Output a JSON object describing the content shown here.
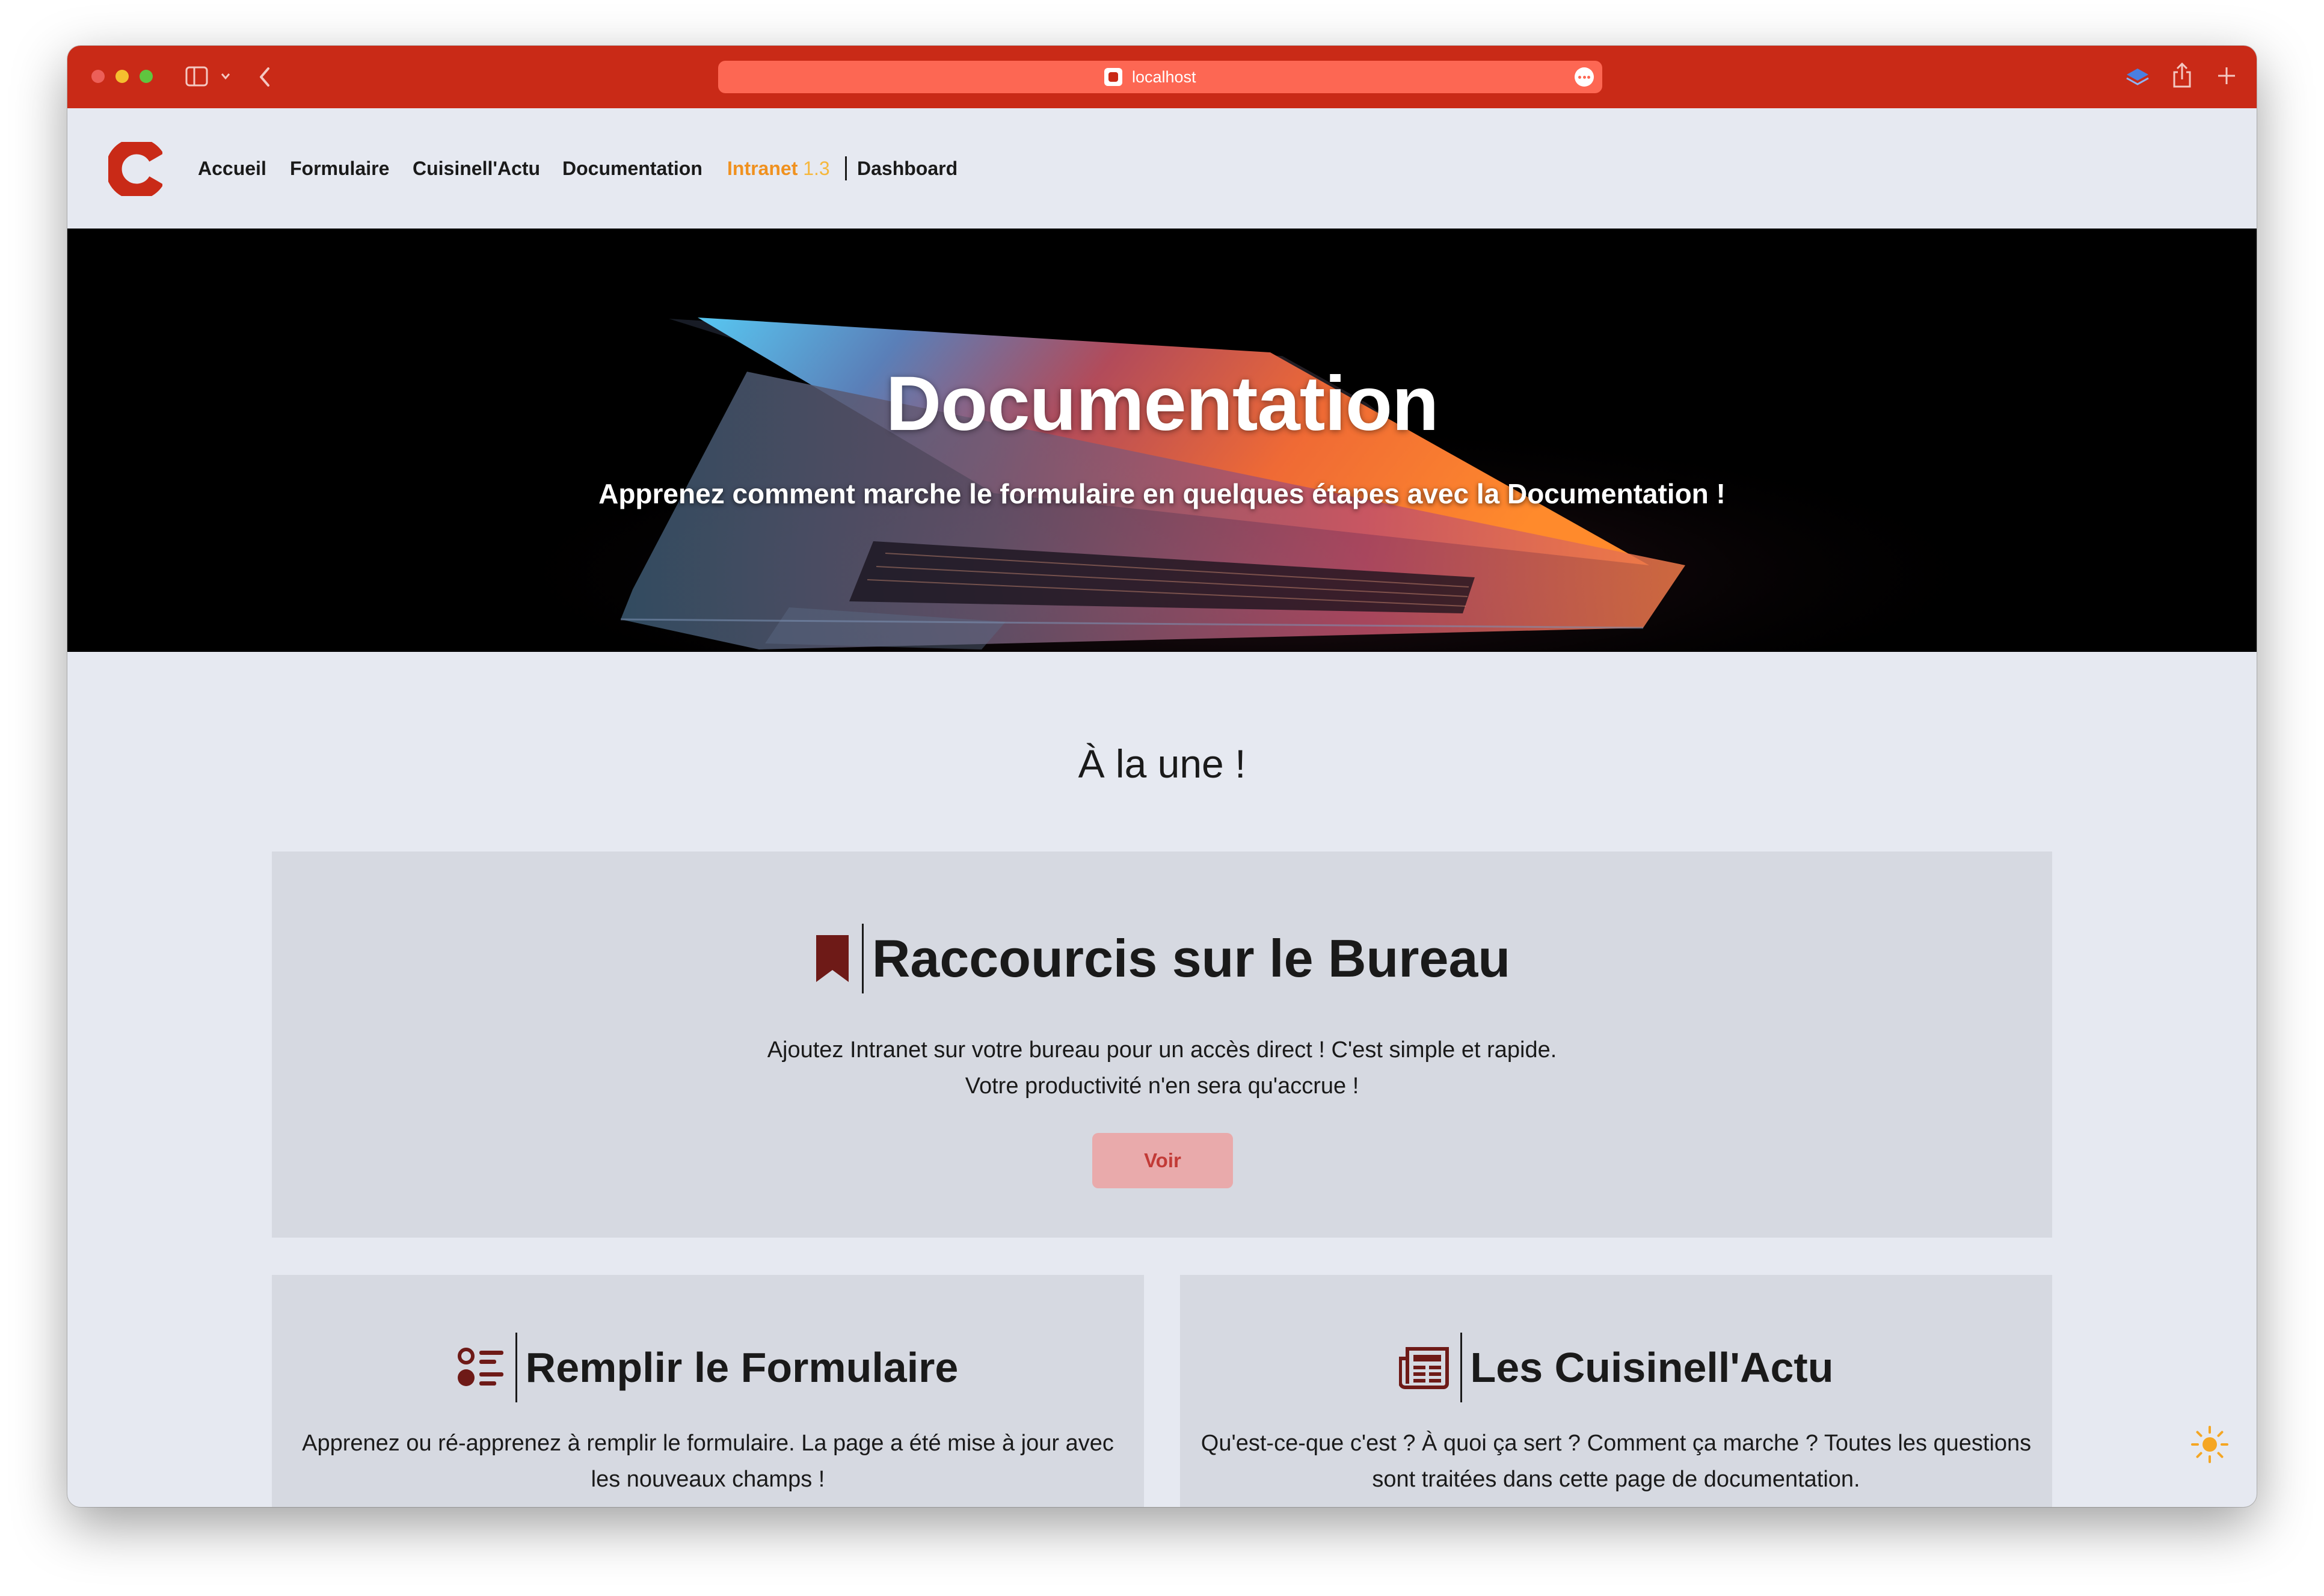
{
  "browser": {
    "url": "localhost",
    "colors": {
      "toolbar": "#c92a17",
      "url_bar": "#fd6753"
    },
    "traffic_lights": [
      "#ec5f58",
      "#f5bf2f",
      "#5fc53f"
    ],
    "icons": [
      "sidebar-toggle-icon",
      "chevron-down-icon",
      "back-arrow-icon",
      "more-options-icon",
      "layers-icon",
      "share-icon",
      "new-tab-plus-icon"
    ]
  },
  "nav": {
    "logo_icon": "cuisinell-c-logo-icon",
    "items": [
      {
        "label": "Accueil"
      },
      {
        "label": "Formulaire"
      },
      {
        "label": "Cuisinell'Actu"
      },
      {
        "label": "Documentation"
      },
      {
        "label": "Intranet",
        "version": "1.3"
      },
      {
        "label": "Dashboard"
      }
    ],
    "active_color": "#f0911f"
  },
  "hero": {
    "title": "Documentation",
    "subtitle": "Apprenez comment marche le formulaire en quelques étapes avec la Documentation !"
  },
  "main": {
    "section_title": "À la une !",
    "featured": {
      "icon": "bookmark-icon",
      "title": "Raccourcis sur le Bureau",
      "line1": "Ajoutez Intranet sur votre bureau pour un accès direct ! C'est simple et rapide.",
      "line2": "Votre productivité n'en sera qu'accrue !",
      "button": "Voir"
    },
    "cards": [
      {
        "icon": "list-icon",
        "title": "Remplir le Formulaire",
        "line1": "Apprenez ou ré-apprenez à remplir le formulaire. La page a été mise à jour avec",
        "line2": "les nouveaux champs !"
      },
      {
        "icon": "newspaper-icon",
        "title": "Les Cuisinell'Actu",
        "line1": "Qu'est-ce-que c'est ? À quoi ça sert ? Comment ça marche ? Toutes les questions",
        "line2": "sont traitées dans cette page de documentation."
      }
    ],
    "icon_color": "#6e1a17",
    "button_color": "#e9aaab"
  },
  "theme_toggle": {
    "icon": "sun-icon",
    "color": "#f5a623"
  }
}
